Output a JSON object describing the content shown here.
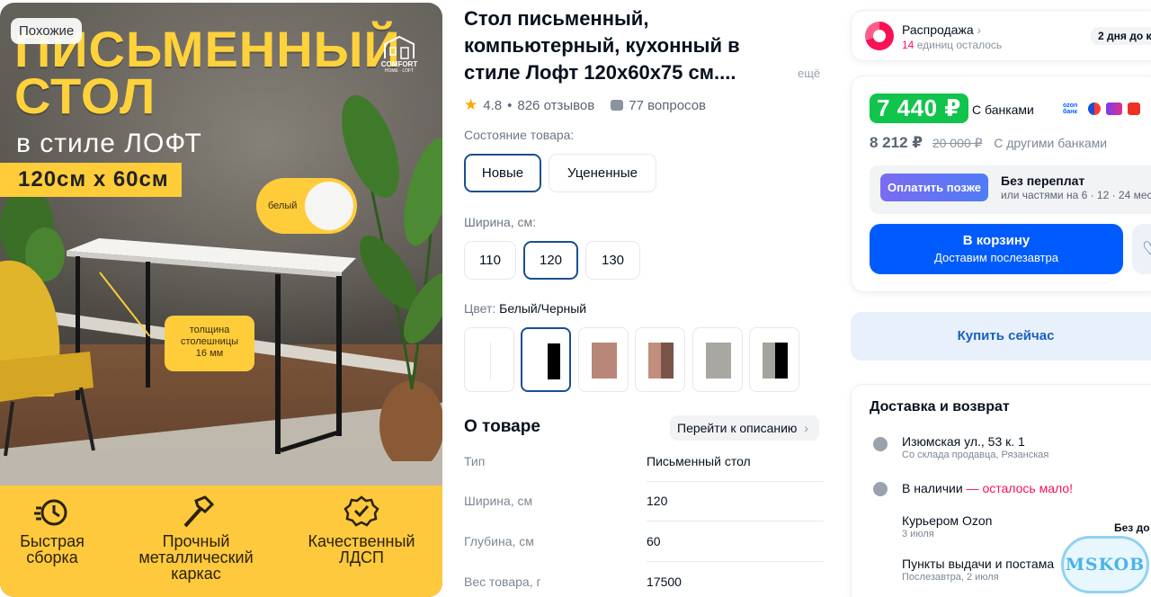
{
  "gallery": {
    "similar_badge": "Похожие",
    "hero_title_1": "ПИСЬМЕННЫЙ",
    "hero_title_2": "СТОЛ",
    "hero_subtitle": "в стиле ЛОФТ",
    "size_tag": "120см х 60см",
    "logo_line1": "COMFORT",
    "logo_line2": "HOME · LOFT",
    "color_chip_label": "белый",
    "thickness_label_1": "толщина",
    "thickness_label_2": "столешницы",
    "thickness_label_3": "16 мм",
    "features": [
      {
        "line1": "Быстрая",
        "line2": "сборка",
        "line3": "",
        "icon": "stopwatch-icon"
      },
      {
        "line1": "Прочный",
        "line2": "металлический",
        "line3": "каркас",
        "icon": "hammer-icon"
      },
      {
        "line1": "Качественный",
        "line2": "ЛДСП",
        "line3": "",
        "icon": "quality-badge-icon"
      }
    ],
    "colors": {
      "accent": "#ffcc3a",
      "title": "#ffd23c"
    }
  },
  "product": {
    "title": "Стол письменный, компьютерный, кухонный в стиле Лофт 120х60х75 см....",
    "more_link": "ещё",
    "rating": "4.8",
    "reviews": "826 отзывов",
    "questions": "77 вопросов",
    "condition_label": "Состояние товара:",
    "conditions": [
      {
        "label": "Новые",
        "selected": true
      },
      {
        "label": "Уцененные",
        "selected": false
      }
    ],
    "width_label": "Ширина, см:",
    "widths": [
      {
        "label": "110",
        "selected": false
      },
      {
        "label": "120",
        "selected": true
      },
      {
        "label": "130",
        "selected": false
      }
    ],
    "color_label": "Цвет:",
    "color_value": "Белый/Черный",
    "swatches": [
      {
        "name": "swatch-white",
        "a": "#ffffff",
        "b": "#ffffff",
        "selected": false
      },
      {
        "name": "swatch-white-black",
        "a": "#ffffff",
        "b": "#000000",
        "selected": true
      },
      {
        "name": "swatch-marble-brown",
        "a": "#b8877a",
        "b": "#9b6e61",
        "selected": false
      },
      {
        "name": "swatch-marble-brown-black",
        "a": "#c28f7f",
        "b": "#000000",
        "selected": false
      },
      {
        "name": "swatch-concrete",
        "a": "#a9a7a1",
        "b": "#8f8d87",
        "selected": false
      },
      {
        "name": "swatch-concrete-black",
        "a": "#a5a39d",
        "b": "#000000",
        "selected": false
      }
    ],
    "about_title": "О товаре",
    "goto_description": "Перейти к описанию",
    "specs": [
      {
        "k": "Тип",
        "v": "Письменный стол"
      },
      {
        "k": "Ширина, см",
        "v": "120"
      },
      {
        "k": "Глубина, см",
        "v": "60"
      },
      {
        "k": "Вес товара, г",
        "v": "17500"
      }
    ]
  },
  "sale": {
    "title": "Распродажа",
    "count": "14",
    "sub": "единиц осталось",
    "pill": "2 дня до к"
  },
  "price": {
    "bank_price": "7 440 ₽",
    "bank_label": "С банками",
    "ozon_bank_1": "ozon",
    "ozon_bank_2": "банк",
    "other_price": "8 212 ₽",
    "old_price": "20 000 ₽",
    "other_label": "С другими банками",
    "later_button": "Оплатить позже",
    "later_title": "Без переплат",
    "later_sub": "или частями на 6 · 12 · 24 мес",
    "cart_title": "В корзину",
    "cart_sub": "Доставим послезавтра",
    "buy_now": "Купить сейчас",
    "colors": {
      "price_green": "#10c44c",
      "ozon_blue": "#005bff",
      "sale_pink": "#f91155"
    }
  },
  "delivery": {
    "title": "Доставка и возврат",
    "address": "Изюмская ул., 53 к. 1",
    "address_sub": "Со склада продавца, Рязанская",
    "stock_prefix": "В наличии",
    "stock_dash": " — ",
    "stock_low": "осталось мало!",
    "courier": "Курьером Ozon",
    "courier_date": "3 июля",
    "courier_right": "Без до",
    "pickup": "Пункты выдачи и постама",
    "pickup_date": "Послезавтра, 2 июля"
  },
  "watermark": "MSKOB"
}
